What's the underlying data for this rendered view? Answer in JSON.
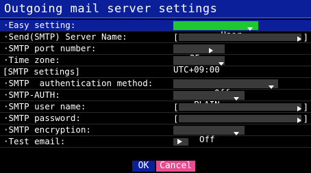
{
  "window": {
    "title": "Outgoing mail server settings"
  },
  "settings": [
    {
      "label": "·Easy setting:",
      "value": "User",
      "kind": "dropdown"
    },
    {
      "label": "·Send(SMTP) Server Name:",
      "value": "",
      "kind": "text"
    },
    {
      "label": "·SMTP port number:",
      "value": "25",
      "kind": "stepper"
    },
    {
      "label": "·Time zone:",
      "value": "UTC+09:00",
      "kind": "dropdown"
    },
    {
      "label": "[SMTP settings]",
      "kind": "section"
    },
    {
      "label": "·SMTP  authentication method:",
      "value": "Off",
      "kind": "dropdown"
    },
    {
      "label": "·SMTP-AUTH:",
      "value": "PLAIN",
      "kind": "dropdown"
    },
    {
      "label": "·SMTP user name:",
      "value": "",
      "kind": "text"
    },
    {
      "label": "·SMTP password:",
      "value": "",
      "kind": "text"
    },
    {
      "label": "·SMTP encryption:",
      "value": "Off",
      "kind": "dropdown"
    },
    {
      "label": "·Test email:",
      "kind": "action"
    }
  ],
  "footer": {
    "ok_label": "OK",
    "cancel_label": "Cancel"
  },
  "colors": {
    "title_bar": "#0c1f9b",
    "selected_value": "#1fc832",
    "field_bg": "#3a3a3a",
    "cancel_button": "#e94b8f"
  },
  "icons": {
    "dropdown": "chevron-down-icon",
    "stepper": "arrow-right-icon",
    "text_field_end": "arrow-right-icon",
    "test_email": "play-icon"
  }
}
